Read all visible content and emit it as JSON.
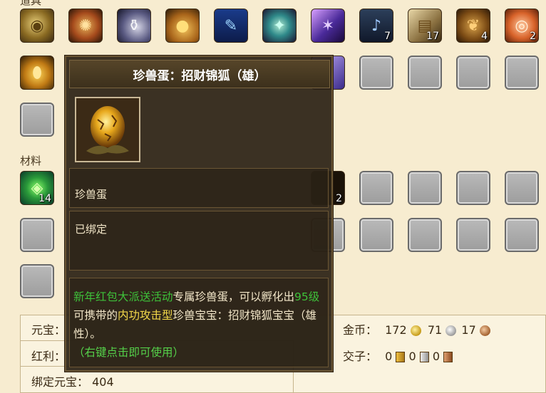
{
  "sections": {
    "tools_label": "道具",
    "materials_label": "材料"
  },
  "row1_items": [
    {
      "name": "coin-medal-icon",
      "count": ""
    },
    {
      "name": "compass-icon",
      "count": ""
    },
    {
      "name": "vase-icon",
      "count": ""
    },
    {
      "name": "gourd-icon",
      "count": ""
    },
    {
      "name": "scroll-icon",
      "count": ""
    },
    {
      "name": "orb-icon",
      "count": ""
    },
    {
      "name": "rune-icon",
      "count": ""
    },
    {
      "name": "lamp-icon",
      "count": "7"
    },
    {
      "name": "bundle-icon",
      "count": "17"
    },
    {
      "name": "food-icon",
      "count": "4"
    },
    {
      "name": "shell-icon",
      "count": "2"
    }
  ],
  "materials": {
    "first_count": "14",
    "hidden_count": "2"
  },
  "currency": {
    "yuanbao_label": "元宝：",
    "hongli_label": "红利：",
    "bound_yuanbao_label": "绑定元宝：",
    "bound_yuanbao_value": "404",
    "gold_label": "金币：",
    "gold_values": [
      "172",
      "71",
      "17"
    ],
    "jiaozi_label": "交子：",
    "jiaozi_values": [
      "0",
      "0",
      "0"
    ]
  },
  "tooltip": {
    "title": "珍兽蛋：招财锦狐（雄）",
    "type": "珍兽蛋",
    "bind_status": "已绑定",
    "desc": {
      "event": "新年红包大派送活动",
      "part1": "专属珍兽蛋，可以孵化出",
      "level": "95级",
      "part2": "可携带的",
      "attack": "内功攻击型",
      "part3": "珍兽宝宝：招财锦狐宝宝（雄性）。",
      "hint": "（右键点击即可使用）"
    }
  },
  "colors": {
    "background": "#f7ecd0",
    "tooltip_bg": "#2c2216",
    "highlight_green": "#3ec23a",
    "highlight_yellow": "#f3d84a"
  }
}
